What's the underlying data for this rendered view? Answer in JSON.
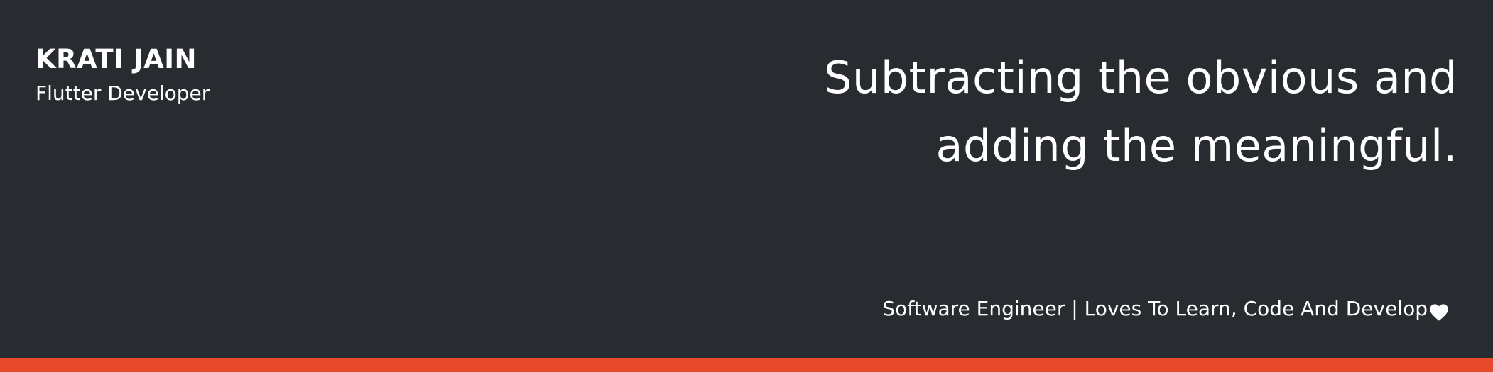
{
  "profile": {
    "name": "KRATI JAIN",
    "role": "Flutter Developer"
  },
  "quote": {
    "line1": "Subtracting the obvious and",
    "line2": "adding the meaningful."
  },
  "tagline": {
    "text": "Software Engineer | Loves To Learn, Code And Develop",
    "icon": "heart-icon"
  },
  "colors": {
    "background": "#282b30",
    "text": "#ffffff",
    "accent": "#e64a2b"
  }
}
